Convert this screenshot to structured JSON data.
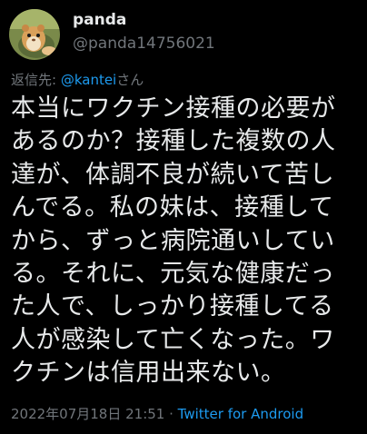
{
  "user": {
    "display_name": "panda",
    "handle": "@panda14756021"
  },
  "reply": {
    "prefix": "返信先: ",
    "mention": "@kantei",
    "suffix": "さん"
  },
  "tweet": {
    "lines": [
      "本当にワクチン接種の必要が",
      "あるのか？接種した複数の人",
      "達が、体調不良が続いて苦し",
      "んでる。私の妹は、接種して",
      "から、ずっと病院通いしてい",
      "る。それに、元気な健康だっ",
      "た人で、しっかり接種してる",
      "人が感染して亡くなった。ワ",
      "クチンは信用出来ない。"
    ]
  },
  "meta": {
    "timestamp": "2022年07月18日 21:51",
    "separator": " · ",
    "client": "Twitter for Android"
  },
  "colors": {
    "background": "#000000",
    "text": "#e7e9ea",
    "secondary": "#71767b",
    "accent": "#1d9bf0"
  },
  "icons": {
    "avatar": "hamster-avatar"
  }
}
